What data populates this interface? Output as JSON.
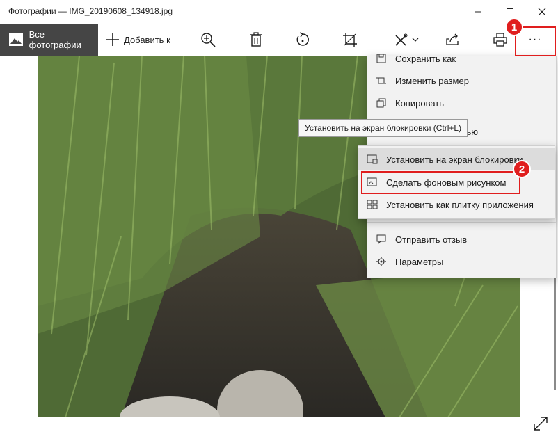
{
  "window": {
    "title": "Фотографии — IMG_20190608_134918.jpg",
    "icons": [
      "minimize-icon",
      "maximize-icon",
      "close-icon"
    ]
  },
  "toolbar": {
    "all_photos_label": "Все фотографии",
    "add_to_label": "Добавить к",
    "icons": [
      "zoom-in-icon",
      "delete-icon",
      "rotate-icon",
      "crop-icon",
      "edit-icon",
      "share-icon",
      "print-icon",
      "more-icon"
    ],
    "more_label": "···"
  },
  "menu": {
    "items": [
      {
        "label": "Сохранить как",
        "icon": "save-icon"
      },
      {
        "label": "Изменить размер",
        "icon": "resize-icon"
      },
      {
        "label": "Копировать",
        "icon": "copy-icon"
      },
      {
        "label": "цью",
        "icon": "set-as-icon"
      },
      {
        "label": "Отправить отзыв",
        "icon": "feedback-icon"
      },
      {
        "label": "Параметры",
        "icon": "settings-icon"
      }
    ]
  },
  "submenu": {
    "items": [
      {
        "label": "Установить на экран блокировки",
        "icon": "lockscreen-icon"
      },
      {
        "label": "Сделать фоновым рисунком",
        "icon": "wallpaper-icon"
      },
      {
        "label": "Установить как плитку приложения",
        "icon": "tile-icon"
      }
    ]
  },
  "tooltip": {
    "text": "Установить на экран блокировки (Ctrl+L)"
  },
  "annotations": {
    "badge1": "1",
    "badge2": "2",
    "highlight_color": "#e01e1e"
  },
  "colors": {
    "toolbar_active_bg": "#454545",
    "menu_bg": "#f2f2f2",
    "menu_hover": "#dcdcdc"
  }
}
